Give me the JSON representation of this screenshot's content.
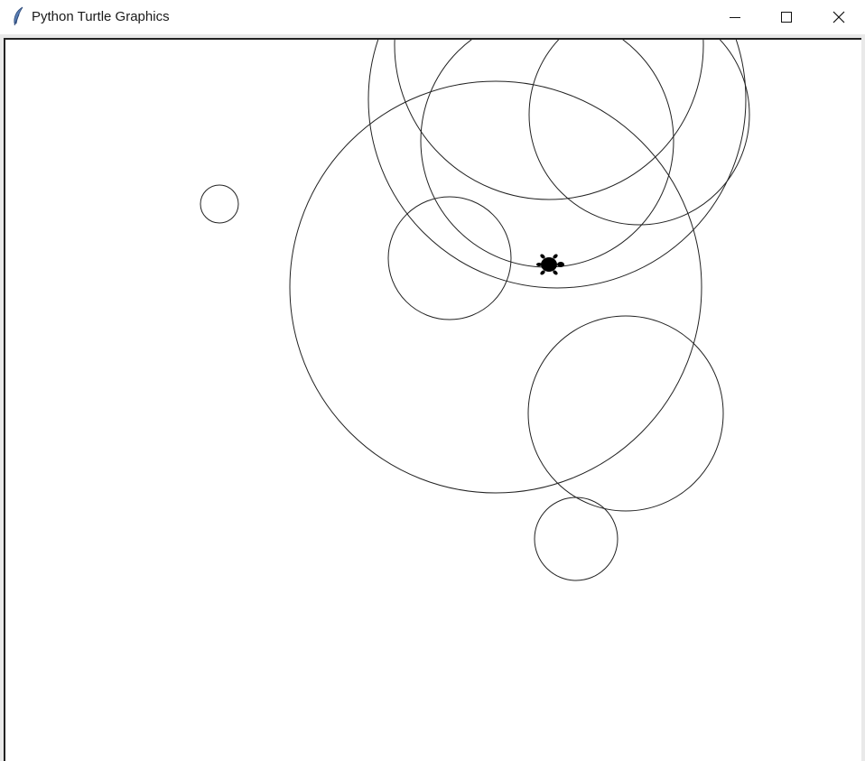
{
  "window": {
    "title": "Python Turtle Graphics",
    "icon": "feather-icon",
    "controls": [
      "minimize-icon",
      "maximize-icon",
      "close-icon"
    ]
  },
  "canvas": {
    "background": "#ffffff",
    "stroke_color": "#222222",
    "turtle_color": "#000000"
  }
}
